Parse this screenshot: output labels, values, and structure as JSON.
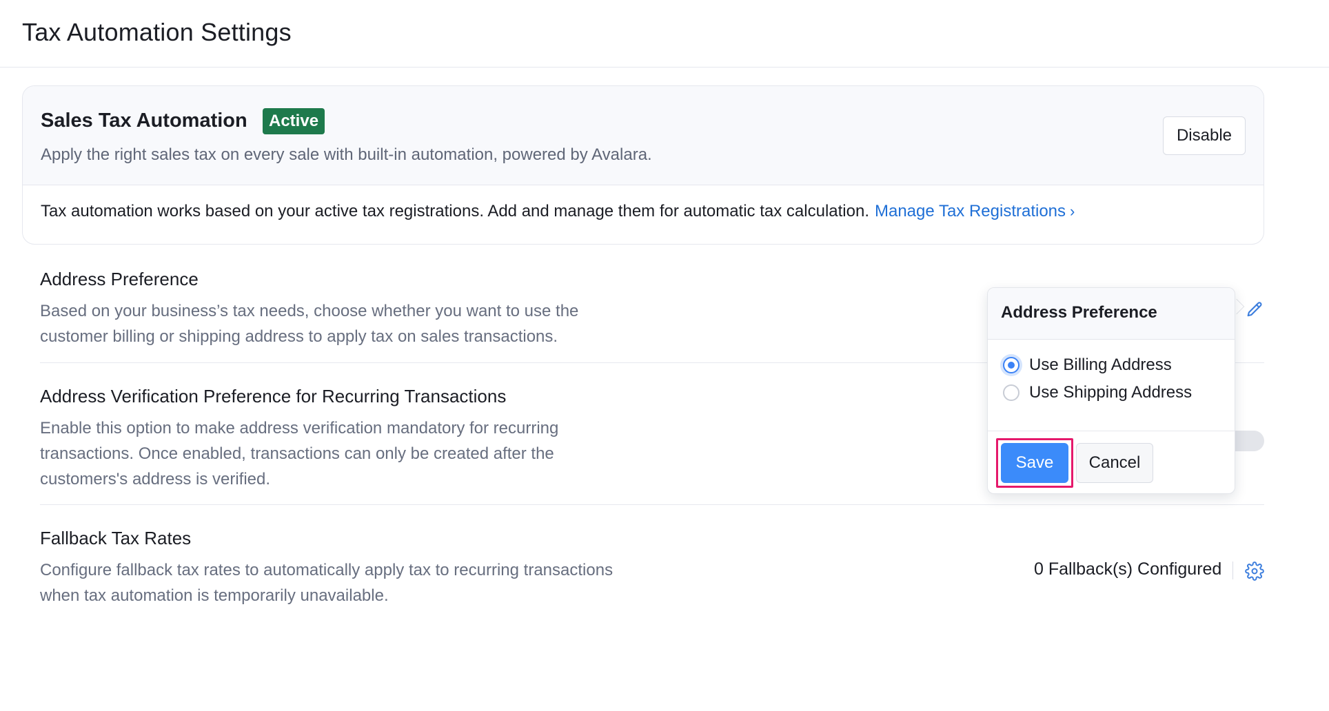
{
  "page": {
    "title": "Tax Automation Settings"
  },
  "sales_tax": {
    "title": "Sales Tax Automation",
    "status_badge": "Active",
    "description": "Apply the right sales tax on every sale with built-in automation, powered by Avalara.",
    "disable_label": "Disable",
    "info_text": "Tax automation works based on your active tax registrations. Add and manage them for automatic tax calculation.",
    "manage_link": "Manage Tax Registrations",
    "manage_link_icon": "chevron-right-icon"
  },
  "address_preference": {
    "title": "Address Preference",
    "description_line1": "Based on your business’s tax needs, choose whether you want to use the",
    "description_line2": "customer billing or shipping address to apply tax on sales transactions.",
    "edit_icon": "pencil-icon"
  },
  "address_verification": {
    "title": "Address Verification Preference for Recurring Transactions",
    "description_line1": "Enable this option to make address verification mandatory for recurring",
    "description_line2": "transactions. Once enabled, transactions can only be created after the",
    "description_line3": "customers's address is verified.",
    "toggle_on": false
  },
  "fallback": {
    "title": "Fallback Tax Rates",
    "description_line1": "Configure fallback tax rates to automatically apply tax to recurring transactions",
    "description_line2": "when tax automation is temporarily unavailable.",
    "configured_text": "0 Fallback(s) Configured",
    "settings_icon": "gear-icon"
  },
  "popover": {
    "title": "Address Preference",
    "options": [
      {
        "label": "Use Billing Address",
        "selected": true
      },
      {
        "label": "Use Shipping Address",
        "selected": false
      }
    ],
    "save_label": "Save",
    "cancel_label": "Cancel"
  },
  "colors": {
    "accent": "#3b8bfa",
    "link": "#1f6fd6",
    "badge_bg": "#1e7a4c",
    "highlight": "#e5196b"
  }
}
